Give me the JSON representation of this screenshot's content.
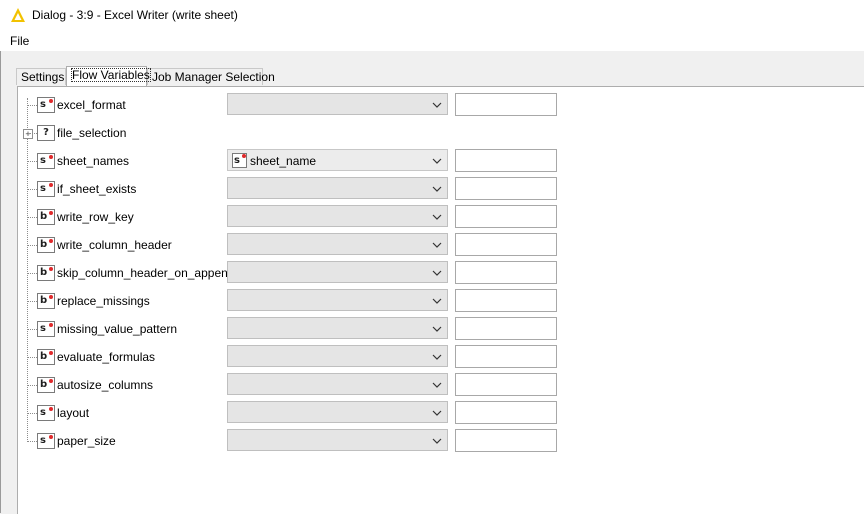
{
  "window": {
    "title": "Dialog - 3:9 - Excel Writer (write sheet)",
    "logo_icon": "knime-triangle-icon",
    "logo_color": "#f2c200"
  },
  "menu": {
    "file": "File"
  },
  "tabs": [
    {
      "label": "Settings",
      "active": false
    },
    {
      "label": "Flow Variables",
      "active": true
    },
    {
      "label": "Job Manager Selection",
      "active": false
    }
  ],
  "flow_variables": [
    {
      "name": "excel_format",
      "type": "s",
      "icon": "string-variable-icon",
      "value": ""
    },
    {
      "name": "file_selection",
      "type": "?",
      "icon": "unknown-variable-icon",
      "expandable": true
    },
    {
      "name": "sheet_names",
      "type": "s",
      "icon": "string-array-variable-icon",
      "value": "sheet_name",
      "value_type": "s"
    },
    {
      "name": "if_sheet_exists",
      "type": "s",
      "icon": "string-variable-icon",
      "value": ""
    },
    {
      "name": "write_row_key",
      "type": "b",
      "icon": "boolean-variable-icon",
      "value": ""
    },
    {
      "name": "write_column_header",
      "type": "b",
      "icon": "boolean-variable-icon",
      "value": ""
    },
    {
      "name": "skip_column_header_on_append",
      "type": "b",
      "icon": "boolean-variable-icon",
      "value": ""
    },
    {
      "name": "replace_missings",
      "type": "b",
      "icon": "boolean-variable-icon",
      "value": ""
    },
    {
      "name": "missing_value_pattern",
      "type": "s",
      "icon": "string-variable-icon",
      "value": ""
    },
    {
      "name": "evaluate_formulas",
      "type": "b",
      "icon": "boolean-variable-icon",
      "value": ""
    },
    {
      "name": "autosize_columns",
      "type": "b",
      "icon": "boolean-variable-icon",
      "value": ""
    },
    {
      "name": "layout",
      "type": "s",
      "icon": "string-variable-icon",
      "value": ""
    },
    {
      "name": "paper_size",
      "type": "s",
      "icon": "string-variable-icon",
      "value": ""
    }
  ]
}
